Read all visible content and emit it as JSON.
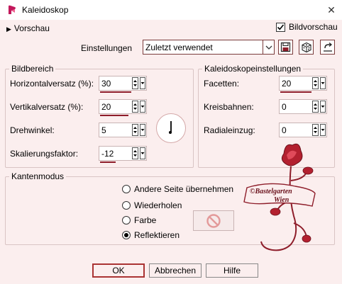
{
  "window": {
    "title": "Kaleidoskop",
    "close_glyph": "✕"
  },
  "top": {
    "preview_label": "Vorschau",
    "image_preview_label": "Bildvorschau",
    "image_preview_checked": true,
    "settings_label": "Einstellungen",
    "settings_value": "Zuletzt verwendet"
  },
  "bildbereich": {
    "title": "Bildbereich",
    "fields": [
      {
        "label": "Horizontalversatz (%):",
        "value": "30"
      },
      {
        "label": "Vertikalversatz (%):",
        "value": "20"
      },
      {
        "label": "Drehwinkel:",
        "value": "5"
      },
      {
        "label": "Skalierungsfaktor:",
        "value": "-12"
      }
    ]
  },
  "kaleido": {
    "title": "Kaleidoskopeinstellungen",
    "fields": [
      {
        "label": "Facetten:",
        "value": "20"
      },
      {
        "label": "Kreisbahnen:",
        "value": "0"
      },
      {
        "label": "Radialeinzug:",
        "value": "0"
      }
    ]
  },
  "kantenmodus": {
    "title": "Kantenmodus",
    "options": [
      {
        "label": "Andere Seite übernehmen",
        "selected": false
      },
      {
        "label": "Wiederholen",
        "selected": false
      },
      {
        "label": "Farbe",
        "selected": false
      },
      {
        "label": "Reflektieren",
        "selected": true
      }
    ]
  },
  "watermark": {
    "line1": "©Bastelgarten",
    "line2": "Wien"
  },
  "buttons": {
    "ok": "OK",
    "cancel": "Abbrechen",
    "help": "Hilfe"
  },
  "colors": {
    "accent": "#8e1d2a",
    "background": "#fbeeee",
    "border": "#7a3b3b"
  }
}
